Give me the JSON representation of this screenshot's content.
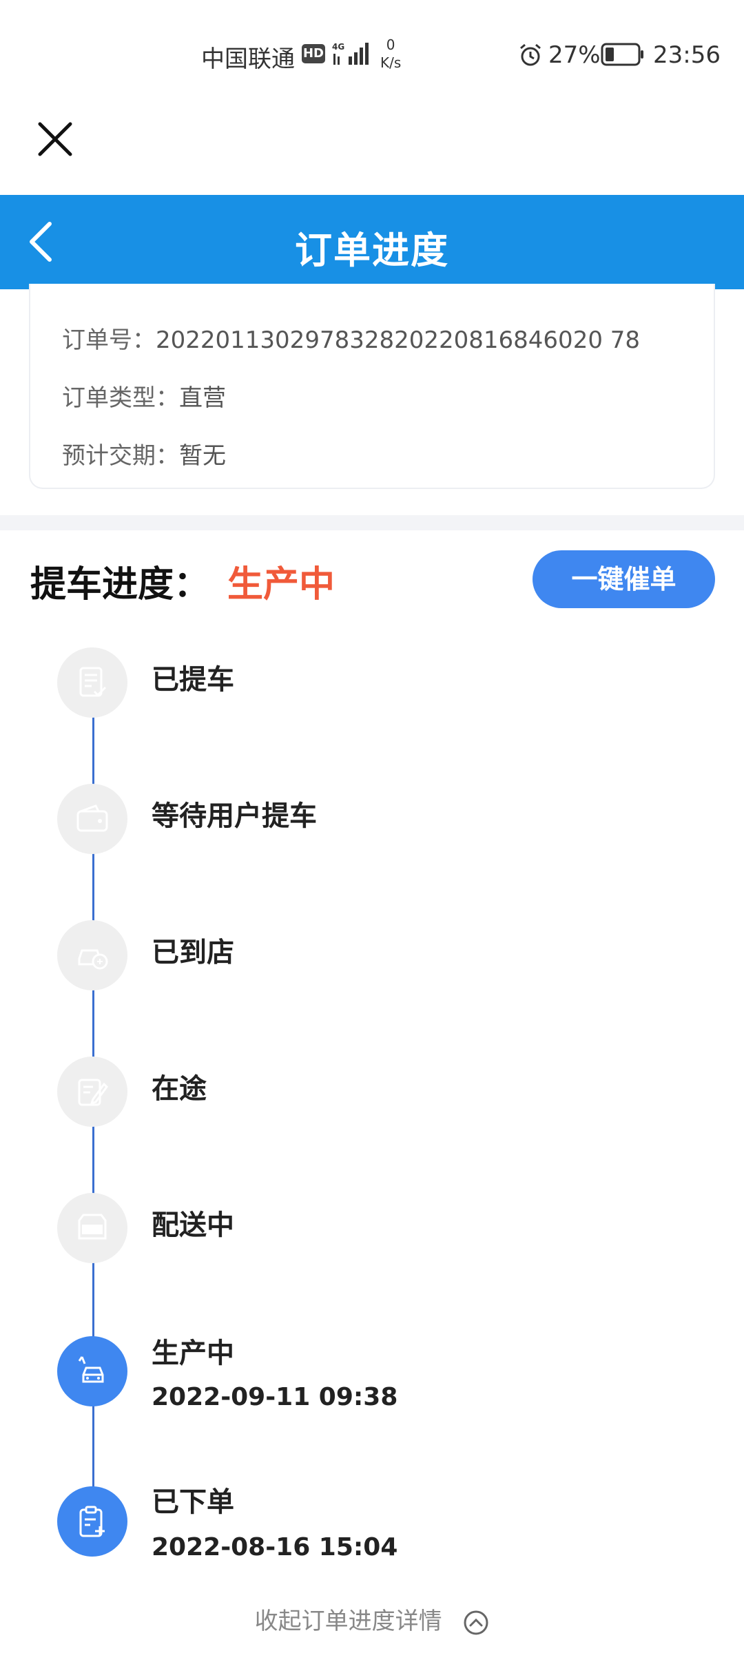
{
  "status_bar": {
    "carrier": "中国联通",
    "hd": "HD",
    "network": "4G",
    "speed_value": "0",
    "speed_unit": "K/s",
    "battery_percent": "27%",
    "time": "23:56"
  },
  "header": {
    "title": "订单进度"
  },
  "order_info": {
    "order_no_label": "订单号：",
    "order_no": "202201130297832820220816846020 78",
    "order_type_label": "订单类型：",
    "order_type": "直营",
    "delivery_label": "预计交期：",
    "delivery": "暂无"
  },
  "progress": {
    "label": "提车进度：",
    "status": "生产中",
    "urge_button": "一键催单"
  },
  "steps": [
    {
      "title": "已提车",
      "time": "",
      "icon": "document-check-icon",
      "active": false
    },
    {
      "title": "等待用户提车",
      "time": "",
      "icon": "wallet-icon",
      "active": false
    },
    {
      "title": "已到店",
      "time": "",
      "icon": "car-receive-icon",
      "active": false
    },
    {
      "title": "在途",
      "time": "",
      "icon": "edit-document-icon",
      "active": false
    },
    {
      "title": "配送中",
      "time": "",
      "icon": "erp-box-icon",
      "active": false
    },
    {
      "title": "生产中",
      "time": "2022-09-11 09:38",
      "icon": "car-production-icon",
      "active": true
    },
    {
      "title": "已下单",
      "time": "2022-08-16 15:04",
      "icon": "clipboard-add-icon",
      "active": true
    }
  ],
  "collapse_label": "收起订单进度详情",
  "colors": {
    "header_blue": "#1890e5",
    "accent_blue": "#3f87f0",
    "status_red": "#f05a3a"
  }
}
